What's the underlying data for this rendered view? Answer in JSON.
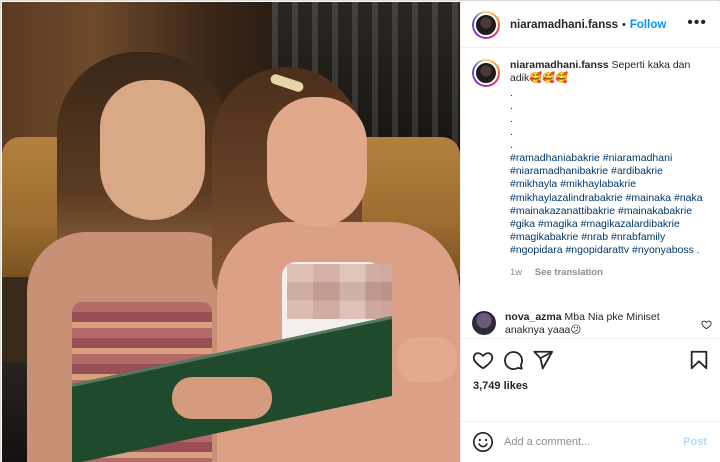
{
  "post": {
    "author": "niaramadhani.fanss",
    "follow_label": "Follow",
    "separator": "•",
    "more_label": "•••"
  },
  "caption": {
    "username": "niaramadhani.fanss",
    "text": "Seperti kaka dan adik🥰🥰🥰",
    "dots": [
      ".",
      ".",
      ".",
      ".",
      "."
    ],
    "hashtags": "#ramadhaniabakrie #niaramadhani #niaramadhanibakrie #ardibakrie #mikhayla #mikhaylabakrie #mikhaylazalindrabakrie #mainaka #naka #mainakazanattibakrie #mainakabakrie #gika #magika #magikazalardibakrie #magikabakrie #nrab #nrabfamily #ngopidara #ngopidarattv #nyonyaboss .",
    "age": "1w",
    "see_translation": "See translation"
  },
  "reply": {
    "username": "nova_azma",
    "text": "Mba Nia pke Miniset anaknya yaaa😕"
  },
  "actions": {
    "icons": [
      "heart-icon",
      "comment-icon",
      "share-icon",
      "bookmark-icon"
    ]
  },
  "likes_label": "3,749 likes",
  "add_comment": {
    "placeholder": "Add a comment...",
    "post_label": "Post"
  },
  "colors": {
    "link": "#0095f6",
    "hashtag": "#00376b",
    "muted": "#8e8e8e",
    "post_disabled": "#b3dbff"
  }
}
